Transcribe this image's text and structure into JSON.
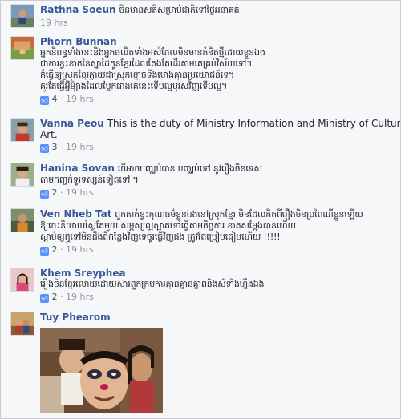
{
  "comments": [
    {
      "author": "Rathna Soeun",
      "lines": [
        "ចិនមានសតិសម្រាប់ជាតិទៅថ្ងៃអនាគត់"
      ],
      "time": "19 hrs"
    },
    {
      "author": "Phorn Bunnan",
      "lines": [
        "អ្នកនិពន្ធទាំងនេះនិងអ្នកផលិតទាំងអស់ដែលមិនមានគំនិតថ្មីដោយខ្លួនឯង",
        "ជាការខ្វះខាតនៃស្នាដៃកូនខ្មែរដែលតែងតែដើរតាមគេគ្រប់វិស័យទៅ។",
        "ក៏ធ្វើឲ្យស្រុកខ្មែរក្លាយជាស្រុកខ្មោចទីងមោងគ្មានប្រយោជន៍ទេ។",
        "គួរតែធ្វើអ្វីម៉្យាងដែលប្លែកជាងគេនេះទើបល្អបុរសវិញទើបល្អ។"
      ],
      "likes": "4",
      "time": "19 hrs"
    },
    {
      "author": "Vanna Peou",
      "lines": [
        "This is the duty of Ministry Information and Ministry of Culture and",
        "Art."
      ],
      "likes": "3",
      "time": "19 hrs"
    },
    {
      "author": "Hanina Sovan",
      "lines": [
        "ចើអាចបញ្ឈប់បាន បញ្ឈប់ទៅ នូវរឿងចិនទេស",
        "តាមកញ្ចក់ទូរទស្សន៍ទៀតទៅ ។"
      ],
      "likes": "2",
      "time": "19 hrs"
    },
    {
      "author": "Ven Nheb Tat",
      "lines": [
        "ពួកគាត់ខ្វះគុណធម៌ខ្លួនឯងនៅស្រុកខ្មែរ មិនដែលគិតពីរឿងចិនប្រពៃណីខ្លួនឡើយ",
        "ឱ្យចេះនិយាយស្ពៃតែមួយ សម្ភស្សល្អស្អាតទៅធ្វើតាមកិច្ចការ ខាតសម្ដែងបានហើយ",
        "ស្ដាប់ឲ្យឮទៅមិនដឹងពីកន្លែងវិញទេចូរធ្វើវិញផង ត្រូវតែប្រៀបធៀបហើយ !!!!!"
      ],
      "likes": "2",
      "time": "19 hrs"
    },
    {
      "author": "Khem Sreyphea",
      "lines": [
        "រឿងចិនខ្មែរលោយដោយសារពួកក្រុមការគ្មានគ្នានគ្នាពនិងសំទាំងហ្នឹងឯង"
      ],
      "likes": "2",
      "time": "19 hrs"
    },
    {
      "author": "Tuy Phearom",
      "lines": [],
      "time": ""
    }
  ],
  "icons": {
    "like": "thumbs-up-icon"
  },
  "colors": {
    "author": "#365899",
    "meta": "#90949c",
    "like_badge": "#5890ff",
    "background": "#f6f7f9"
  }
}
